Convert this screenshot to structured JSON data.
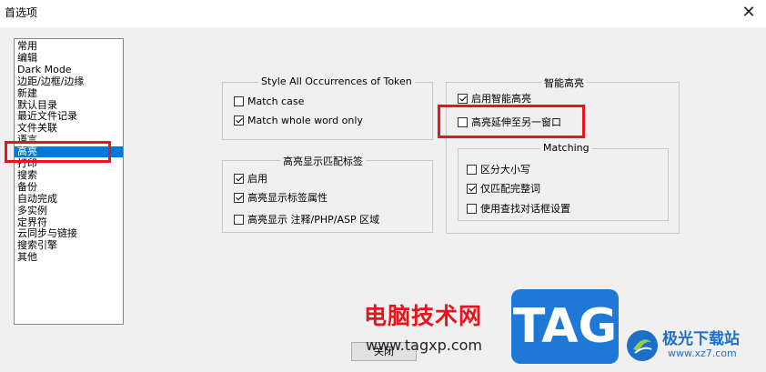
{
  "window": {
    "title": "首选项",
    "close_glyph": "✕",
    "close_icon": "close-icon"
  },
  "sidebar": {
    "items": [
      {
        "label": "常用"
      },
      {
        "label": "编辑"
      },
      {
        "label": "Dark Mode"
      },
      {
        "label": "边距/边框/边缘"
      },
      {
        "label": "新建"
      },
      {
        "label": "默认目录"
      },
      {
        "label": "最近文件记录"
      },
      {
        "label": "文件关联"
      },
      {
        "label": "语言"
      },
      {
        "label": "高亮",
        "selected": true
      },
      {
        "label": "打印"
      },
      {
        "label": "搜索"
      },
      {
        "label": "备份"
      },
      {
        "label": "自动完成"
      },
      {
        "label": "多实例"
      },
      {
        "label": "定界符"
      },
      {
        "label": "云同步与链接"
      },
      {
        "label": "搜索引擎"
      },
      {
        "label": "其他"
      }
    ]
  },
  "style_all": {
    "title": "Style All Occurrences of Token",
    "match_case": {
      "label": "Match case",
      "checked": false
    },
    "match_whole_word": {
      "label": "Match whole word only",
      "checked": true
    }
  },
  "tag_match": {
    "title": "高亮显示匹配标签",
    "enable": {
      "label": "启用",
      "checked": true
    },
    "tag_attr": {
      "label": "高亮显示标签属性",
      "checked": true
    },
    "comment_zone": {
      "label": "高亮显示 注释/PHP/ASP 区域",
      "checked": false
    }
  },
  "smart_highlight": {
    "title": "智能高亮",
    "enable": {
      "label": "启用智能高亮",
      "checked": true
    },
    "extend_other_view": {
      "label": "高亮延伸至另一窗口",
      "checked": false
    },
    "matching": {
      "title": "Matching",
      "match_case": {
        "label": "区分大小写",
        "checked": false
      },
      "whole_word": {
        "label": "仅匹配完整词",
        "checked": true
      },
      "use_find_settings": {
        "label": "使用查找对话框设置",
        "checked": false
      }
    }
  },
  "footer": {
    "close_label": "关闭"
  },
  "watermark": {
    "text": "电脑技术网",
    "url": "www.tagxp.com",
    "tag": "TAG",
    "site_name": "极光下载站",
    "site_url": "www.xz7.com"
  },
  "colors": {
    "selection": "#0078d7",
    "annotation_red": "#e8141d",
    "watermark_blue": "#1e78d8"
  }
}
